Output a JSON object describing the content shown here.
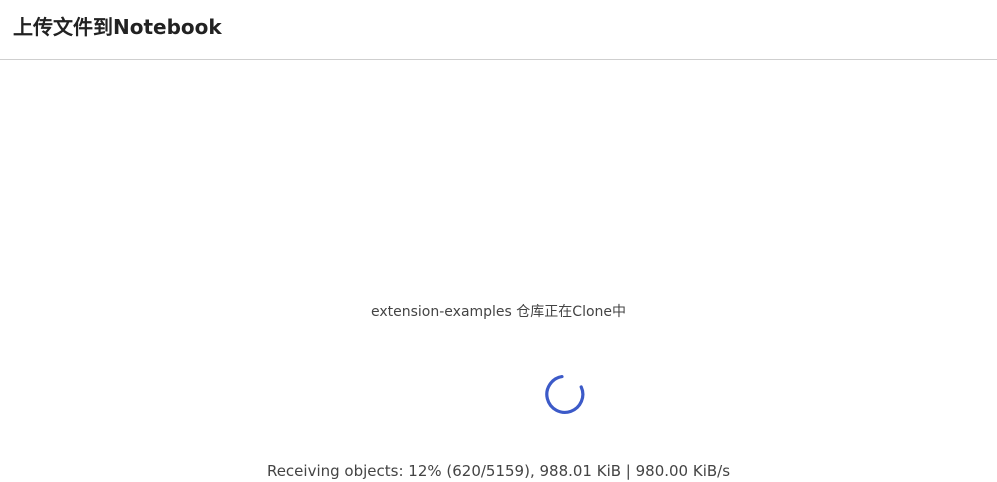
{
  "dialog": {
    "title": "上传文件到Notebook"
  },
  "clone": {
    "status": "extension-examples 仓库正在Clone中",
    "progress": "Receiving objects: 12% (620/5159), 988.01 KiB | 980.00 KiB/s",
    "spinner_icon": "loading-spinner-icon",
    "spinner_color": "#3c5ac8"
  }
}
